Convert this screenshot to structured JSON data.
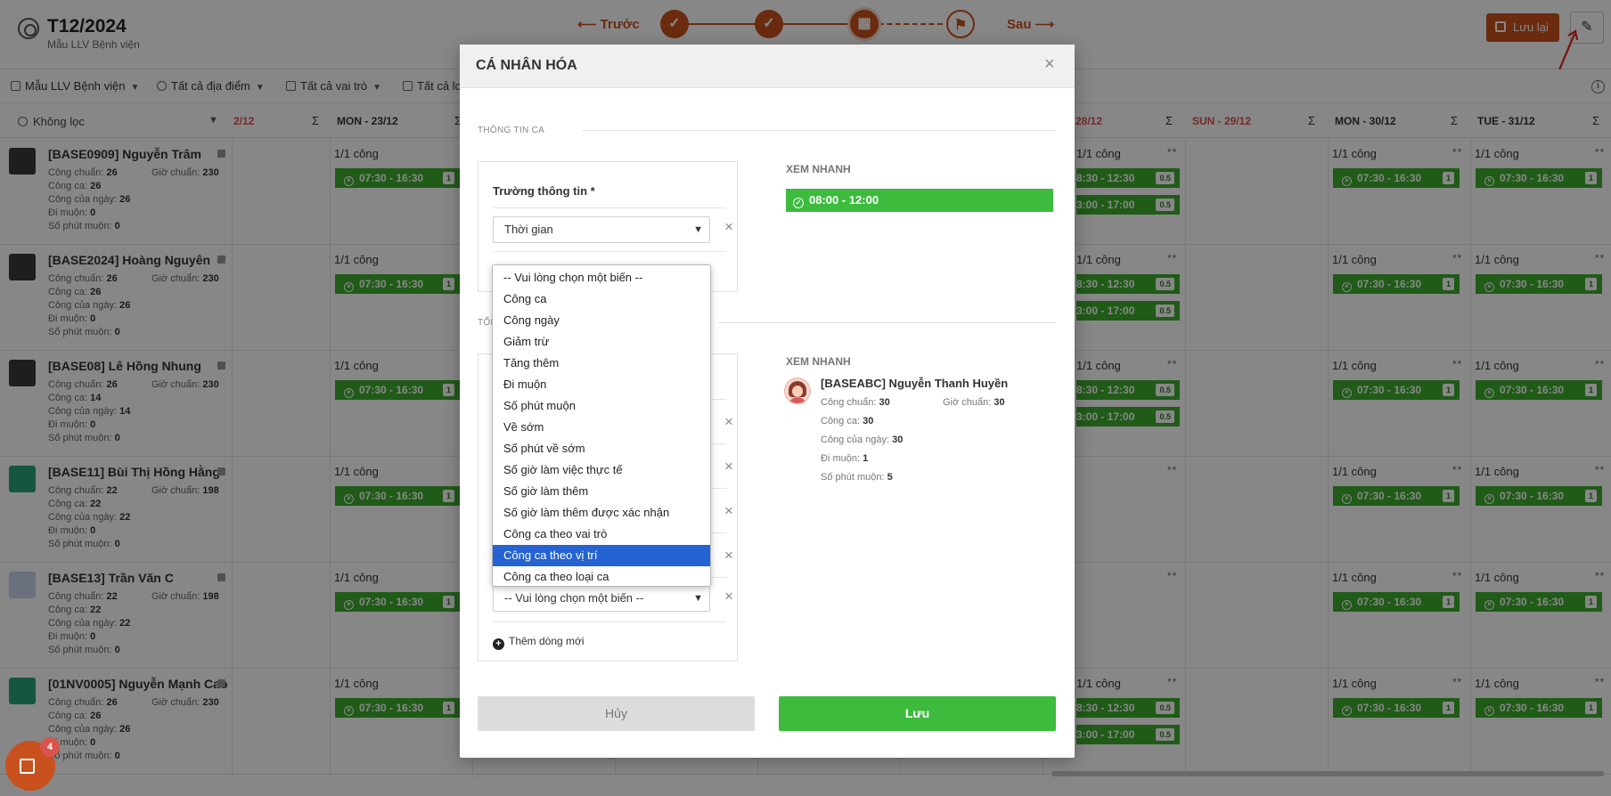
{
  "header": {
    "title": "T12/2024",
    "subtitle": "Mẫu LLV Bệnh viện",
    "prev_label": "⟵ Trước",
    "next_label": "Sau ⟶",
    "save_label": "Lưu lại",
    "steps": [
      "✓",
      "✓",
      "▦",
      "⚑"
    ]
  },
  "filters": {
    "template": "Mẫu LLV Bệnh viện",
    "locations": "Tất cả địa điểm",
    "roles": "Tất cả vai trò",
    "other": "Tất cả lo"
  },
  "grid": {
    "search_label": "Không lọc",
    "sigma": "Σ",
    "columns": [
      {
        "label": "2/12",
        "weekend": true
      },
      {
        "label": "MON - 23/12",
        "weekend": false
      },
      {
        "label": "28/12",
        "weekend": true
      },
      {
        "label": "SUN - 29/12",
        "weekend": true
      },
      {
        "label": "MON - 30/12",
        "weekend": false
      },
      {
        "label": "TUE - 31/12",
        "weekend": false
      }
    ],
    "stat_labels": {
      "cong_chuan": "Công chuẩn:",
      "gio_chuan": "Giờ chuẩn:",
      "cong_ca": "Công ca:",
      "cong_cua_ngay": "Công của ngày:",
      "di_muon": "Đi muộn:",
      "so_phut_muon": "Số phút muộn:"
    },
    "cong_text": "1/1 công",
    "stars": "**",
    "shift_main": "07:30 - 16:30",
    "shift_main_num": "1",
    "shift_split_a": "8:30 - 12:30",
    "shift_split_b": "3:00 - 17:00",
    "shift_split_num": "0.5",
    "employees": [
      {
        "name": "[BASE0909] Nguyễn Trâm",
        "cong_chuan": "26",
        "gio_chuan": "230",
        "cong_ca": "26",
        "cong_cua_ngay": "26",
        "di_muon": "0",
        "so_phut_muon": "0",
        "avatar": "photo"
      },
      {
        "name": "[BASE2024] Hoàng Nguyên",
        "cong_chuan": "26",
        "gio_chuan": "230",
        "cong_ca": "26",
        "cong_cua_ngay": "26",
        "di_muon": "0",
        "so_phut_muon": "0",
        "avatar": "photo"
      },
      {
        "name": "[BASE08] Lê Hồng Nhung",
        "cong_chuan": "26",
        "gio_chuan": "230",
        "cong_ca": "14",
        "cong_cua_ngay": "14",
        "di_muon": "0",
        "so_phut_muon": "0",
        "avatar": "photo"
      },
      {
        "name": "[BASE11] Bùi Thị Hồng Hằng",
        "cong_chuan": "22",
        "gio_chuan": "198",
        "cong_ca": "22",
        "cong_cua_ngay": "22",
        "di_muon": "0",
        "so_phut_muon": "0",
        "avatar": "green"
      },
      {
        "name": "[BASE13] Trần Văn C",
        "cong_chuan": "22",
        "gio_chuan": "198",
        "cong_ca": "22",
        "cong_cua_ngay": "22",
        "di_muon": "0",
        "so_phut_muon": "0",
        "avatar": "light"
      },
      {
        "name": "[01NV0005] Nguyễn Mạnh Cao",
        "cong_chuan": "26",
        "gio_chuan": "230",
        "cong_ca": "26",
        "cong_cua_ngay": "26",
        "di_muon": "0",
        "so_phut_muon": "0",
        "avatar": "green"
      }
    ]
  },
  "fab": {
    "badge": "4"
  },
  "modal": {
    "title": "CÁ NHÂN HÓA",
    "close": "×",
    "section1": "THÔNG TIN CA",
    "section2": "TỔN",
    "field_label": "Trường thông tin *",
    "field_value": "Thời gian",
    "quick_view": "XEM NHANH",
    "quick_shift": "08:00 - 12:00",
    "empty_select": "-- Vui lòng chọn một biến --",
    "add_row": "Thêm dòng mới",
    "remove": "×",
    "cancel": "Hủy",
    "save": "Lưu",
    "preview": {
      "name": "[BASEABC] Nguyễn Thanh Huyền",
      "cong_chuan_label": "Công chuẩn:",
      "cong_chuan": "30",
      "gio_chuan_label": "Giờ chuẩn:",
      "gio_chuan": "30",
      "cong_ca_label": "Công ca:",
      "cong_ca": "30",
      "cong_cua_ngay_label": "Công của ngày:",
      "cong_cua_ngay": "30",
      "di_muon_label": "Đi muộn:",
      "di_muon": "1",
      "so_phut_muon_label": "Số phút muộn:",
      "so_phut_muon": "5"
    }
  },
  "dropdown": {
    "options": [
      "-- Vui lòng chọn một biến --",
      "Công ca",
      "Công ngày",
      "Giảm trừ",
      "Tăng thêm",
      "Đi muộn",
      "Số phút muộn",
      "Về sớm",
      "Số phút về sớm",
      "Số giờ làm việc thực tế",
      "Số giờ làm thêm",
      "Số giờ làm thêm được xác nhận",
      "Công ca theo vai trò",
      "Công ca theo vị trí",
      "Công ca theo loại ca"
    ],
    "selected_index": 13
  }
}
